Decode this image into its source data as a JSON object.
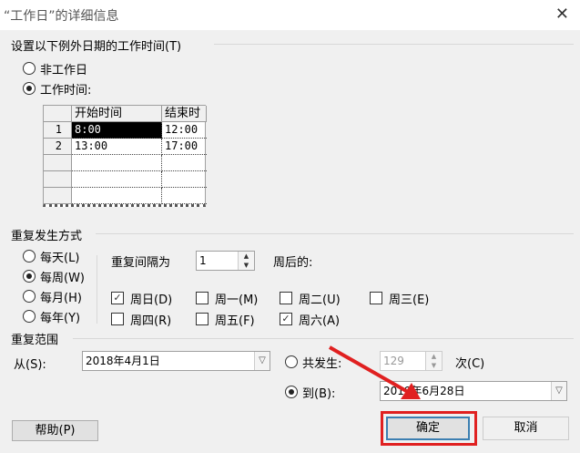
{
  "title": "“工作日”的详细信息",
  "section_worktime": "设置以下例外日期的工作时间(T)",
  "radio_nonwork": "非工作日",
  "radio_worktime": "工作时间:",
  "grid": {
    "headers": [
      "开始时间",
      "结束时"
    ],
    "rows": [
      [
        "1",
        "8:00",
        "12:00"
      ],
      [
        "2",
        "13:00",
        "17:00"
      ],
      [
        "",
        "",
        ""
      ],
      [
        "",
        "",
        ""
      ],
      [
        "",
        "",
        ""
      ]
    ]
  },
  "section_recur": "重复发生方式",
  "recur_options": [
    "每天(L)",
    "每周(W)",
    "每月(H)",
    "每年(Y)"
  ],
  "interval_label": "重复间隔为",
  "interval_value": "1",
  "weeks_after": "周后的:",
  "days": [
    {
      "label": "周日(D)",
      "checked": true
    },
    {
      "label": "周一(M)",
      "checked": false
    },
    {
      "label": "周二(U)",
      "checked": false
    },
    {
      "label": "周三(E)",
      "checked": false
    },
    {
      "label": "周四(R)",
      "checked": false
    },
    {
      "label": "周五(F)",
      "checked": false
    },
    {
      "label": "周六(A)",
      "checked": true
    }
  ],
  "section_range": "重复范围",
  "from_label": "从(S):",
  "from_value": "2018年4月1日",
  "occur_label": "共发生:",
  "occur_value": "129",
  "times_label": "次(C)",
  "to_label": "到(B):",
  "to_value": "2019年6月28日",
  "help_label": "帮助(P)",
  "ok_label": "确定",
  "cancel_label": "取消",
  "annotation_color": "#e02020"
}
